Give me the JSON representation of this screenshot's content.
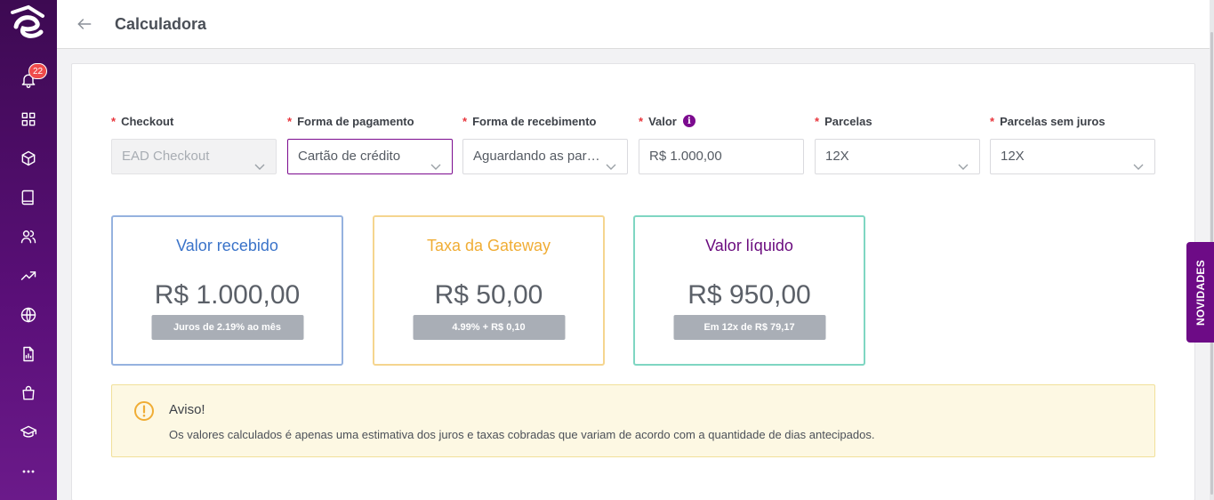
{
  "badge_count": "22",
  "header": {
    "title": "Calculadora"
  },
  "fields": [
    {
      "label": "Checkout",
      "value": "EAD Checkout",
      "state": "disabled"
    },
    {
      "label": "Forma de pagamento",
      "value": "Cartão de crédito",
      "state": "active"
    },
    {
      "label": "Forma de recebimento",
      "value": "Aguardando as parcelas",
      "state": "normal"
    },
    {
      "label": "Valor",
      "value": "R$ 1.000,00",
      "state": "input"
    },
    {
      "label": "Parcelas",
      "value": "12X",
      "state": "normal"
    },
    {
      "label": "Parcelas sem juros",
      "value": "12X",
      "state": "normal"
    }
  ],
  "results": [
    {
      "title": "Valor recebido",
      "value": "R$ 1.000,00",
      "sub": "Juros de 2.19% ao mês",
      "color": "#3a73c9",
      "border": "#95b2df"
    },
    {
      "title": "Taxa da Gateway",
      "value": "R$ 50,00",
      "sub": "4.99% + R$ 0,10",
      "color": "#f0ad35",
      "border": "#f5d58f"
    },
    {
      "title": "Valor líquido",
      "value": "R$ 950,00",
      "sub": "Em 12x de R$ 79,17",
      "color": "#6a0b7e",
      "border": "#7fd6c2"
    }
  ],
  "alert": {
    "title": "Aviso!",
    "text": "Os valores calculados é apenas uma estimativa dos juros e taxas cobradas que variam de acordo com a quantidade de dias antecipados."
  },
  "novidades_label": "NOVIDADES",
  "colors": {
    "accent": "#7c0b8f",
    "required": "#e8363d",
    "sidebar": "#4a0d63"
  },
  "sidebar_icons": [
    "logo-icon",
    "bell-icon",
    "grid-icon",
    "box-icon",
    "book-icon",
    "users-icon",
    "trending-up-icon",
    "globe-icon",
    "report-icon",
    "shopping-bag-icon",
    "graduation-cap-icon",
    "more-icon"
  ]
}
